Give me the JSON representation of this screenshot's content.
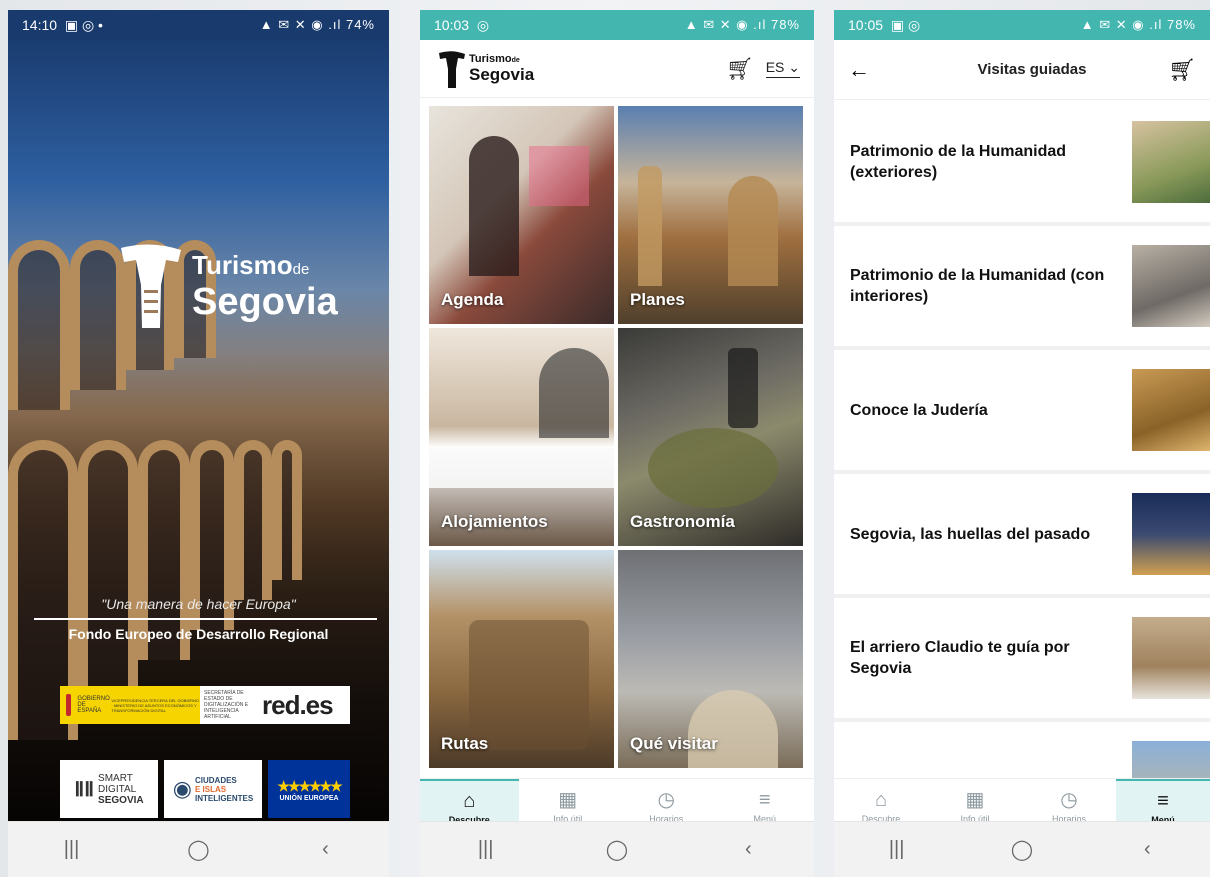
{
  "phone1": {
    "status": {
      "time": "14:10",
      "left_icons": "▣ ◎ •",
      "right_icons": "▲ ✉ ✕ ◉ .ıl",
      "battery": "74%"
    },
    "brand": {
      "line1": "Turismo",
      "de": "de",
      "line2": "Segovia"
    },
    "tagline": "\"Una manera de hacer Europa\"",
    "fondo": "Fondo Europeo de Desarrollo Regional",
    "sponsors": {
      "gob_text": "GOBIERNO DE ESPAÑA",
      "ministerio_text": "VICEPRESIDENCIA TERCERA DEL GOBIERNO · MINISTERIO DE ASUNTOS ECONÓMICOS Y TRANSFORMACIÓN DIGITAL",
      "secretaria_text": "SECRETARÍA DE ESTADO DE DIGITALIZACIÓN E INTELIGENCIA ARTIFICIAL",
      "redes": "red.es",
      "smart_lines": [
        "SMART",
        "DIGITAL",
        "SEGOVIA"
      ],
      "ciudades_lines": [
        "CIUDADES",
        "E ISLAS",
        "INTELIGENTES"
      ],
      "ue": "UNIÓN EUROPEA"
    }
  },
  "phone2": {
    "status": {
      "time": "10:03",
      "left_icons": "◎",
      "right_icons": "▲ ✉ ✕ ◉ .ıl",
      "battery": "78%"
    },
    "logo": {
      "line1": "Turismo",
      "de": "de",
      "line2": "Segovia"
    },
    "lang": "ES",
    "tiles": [
      {
        "label": "Agenda"
      },
      {
        "label": "Planes"
      },
      {
        "label": "Alojamientos"
      },
      {
        "label": "Gastronomía"
      },
      {
        "label": "Rutas"
      },
      {
        "label": "Qué visitar"
      }
    ],
    "nav": [
      {
        "label": "Descubre",
        "icon": "⌂"
      },
      {
        "label": "Info útil",
        "icon": "▦"
      },
      {
        "label": "Horarios",
        "icon": "◷"
      },
      {
        "label": "Menú",
        "icon": "≡"
      }
    ]
  },
  "phone3": {
    "status": {
      "time": "10:05",
      "left_icons": "▣ ◎",
      "right_icons": "▲ ✉ ✕ ◉ .ıl",
      "battery": "78%"
    },
    "title": "Visitas guiadas",
    "items": [
      {
        "title": "Patrimonio de la Humanidad (exteriores)"
      },
      {
        "title": "Patrimonio de la Humanidad (con interiores)"
      },
      {
        "title": "Conoce la Judería"
      },
      {
        "title": "Segovia, las huellas del pasado"
      },
      {
        "title": "El arriero Claudio te guía por Segovia"
      },
      {
        "title": ""
      }
    ],
    "nav": [
      {
        "label": "Descubre",
        "icon": "⌂"
      },
      {
        "label": "Info útil",
        "icon": "▦"
      },
      {
        "label": "Horarios",
        "icon": "◷"
      },
      {
        "label": "Menú",
        "icon": "≡"
      }
    ]
  },
  "system_nav": {
    "recents": "|||",
    "home": "◯",
    "back": "‹"
  },
  "colors": {
    "accent": "#43b6b0",
    "active_tab_bg": "#e2f3f3"
  }
}
